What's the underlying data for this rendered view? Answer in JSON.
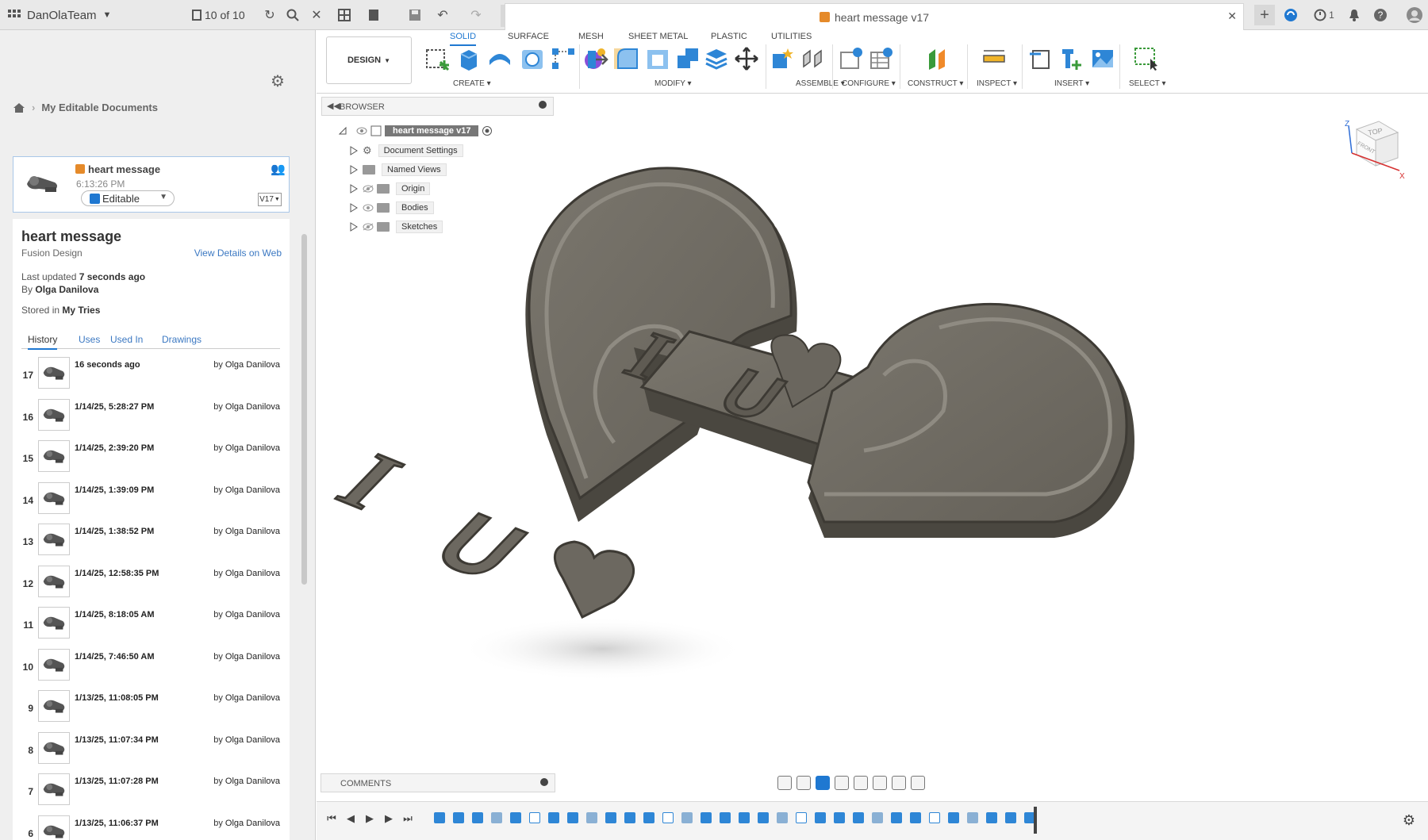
{
  "topbar": {
    "team_name": "DanOlaTeam",
    "doc_count": "10 of 10",
    "doc_tab_title": "heart message v17",
    "jobs_count": "1"
  },
  "left_panel": {
    "breadcrumb": "My Editable Documents",
    "doc_card": {
      "name": "heart message",
      "time": "6:13:26 PM",
      "status": "Editable",
      "version": "V17"
    },
    "details": {
      "title": "heart message",
      "type": "Fusion Design",
      "view_web": "View Details on Web",
      "updated_label": "Last updated",
      "updated_value": "7 seconds ago",
      "by_label": "By",
      "by_value": "Olga Danilova",
      "stored_label": "Stored in",
      "stored_value": "My Tries"
    },
    "tabs": [
      "History",
      "Uses",
      "Used In",
      "Drawings"
    ],
    "history": [
      {
        "num": "17",
        "date": "16 seconds ago",
        "by": "Olga Danilova"
      },
      {
        "num": "16",
        "date": "1/14/25, 5:28:27 PM",
        "by": "Olga Danilova"
      },
      {
        "num": "15",
        "date": "1/14/25, 2:39:20 PM",
        "by": "Olga Danilova"
      },
      {
        "num": "14",
        "date": "1/14/25, 1:39:09 PM",
        "by": "Olga Danilova"
      },
      {
        "num": "13",
        "date": "1/14/25, 1:38:52 PM",
        "by": "Olga Danilova"
      },
      {
        "num": "12",
        "date": "1/14/25, 12:58:35 PM",
        "by": "Olga Danilova"
      },
      {
        "num": "11",
        "date": "1/14/25, 8:18:05 AM",
        "by": "Olga Danilova"
      },
      {
        "num": "10",
        "date": "1/14/25, 7:46:50 AM",
        "by": "Olga Danilova"
      },
      {
        "num": "9",
        "date": "1/13/25, 11:08:05 PM",
        "by": "Olga Danilova"
      },
      {
        "num": "8",
        "date": "1/13/25, 11:07:34 PM",
        "by": "Olga Danilova"
      },
      {
        "num": "7",
        "date": "1/13/25, 11:07:28 PM",
        "by": "Olga Danilova"
      },
      {
        "num": "6",
        "date": "1/13/25, 11:06:37 PM",
        "by": "Olga Danilova"
      }
    ],
    "by_prefix": "by"
  },
  "toolbar": {
    "workspace": "DESIGN",
    "tabs": [
      "SOLID",
      "SURFACE",
      "MESH",
      "SHEET METAL",
      "PLASTIC",
      "UTILITIES"
    ],
    "groups": [
      "CREATE",
      "MODIFY",
      "ASSEMBLE",
      "CONFIGURE",
      "CONSTRUCT",
      "INSPECT",
      "INSERT",
      "SELECT"
    ]
  },
  "browser": {
    "header": "BROWSER",
    "root": "heart message v17",
    "items": [
      "Document Settings",
      "Named Views",
      "Origin",
      "Bodies",
      "Sketches"
    ]
  },
  "comments": {
    "header": "COMMENTS"
  },
  "viewcube": {
    "top": "TOP",
    "front": "FRONT",
    "x": "X",
    "z": "Z"
  },
  "model": {
    "letter_i": "I",
    "letter_u": "U"
  },
  "colors": {
    "accent": "#1f78d1",
    "model_face": "#6f6b62",
    "model_dark": "#4a4740",
    "doc_cube": "#e58a2a"
  }
}
